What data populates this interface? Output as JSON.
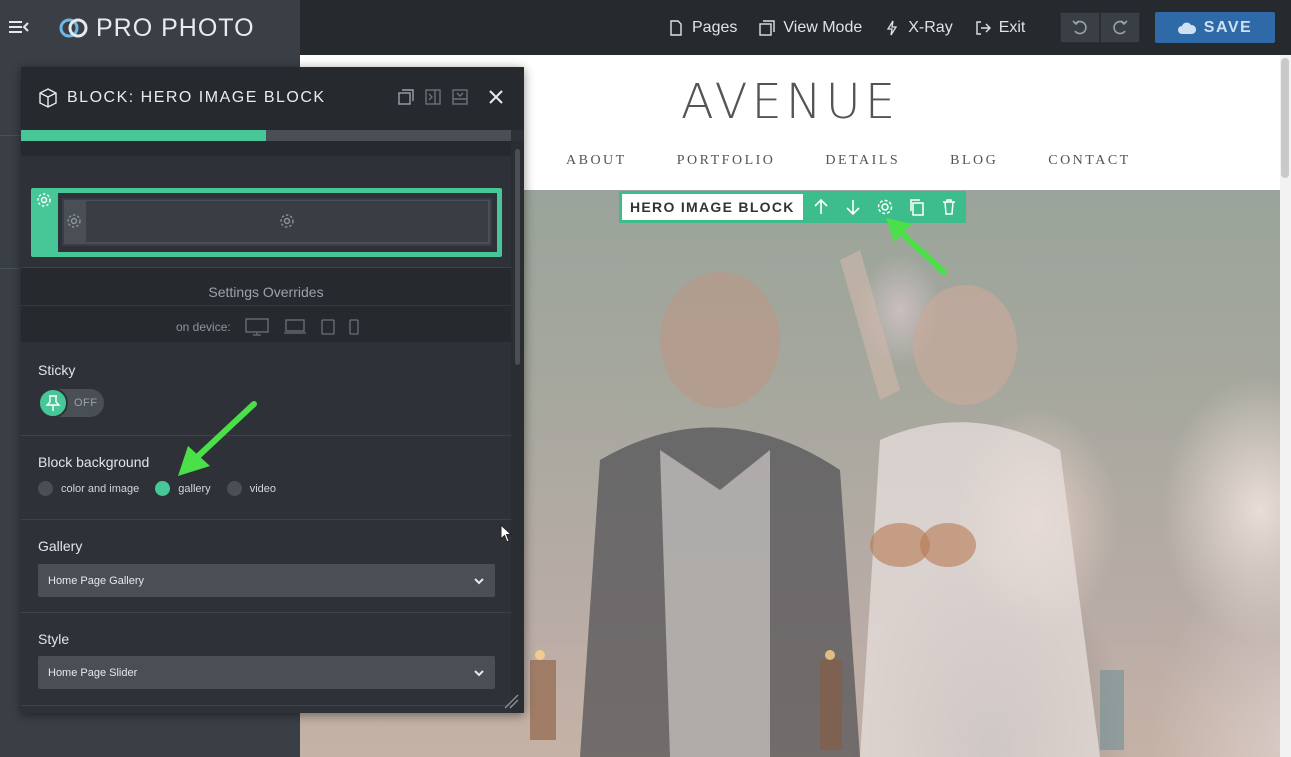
{
  "app": {
    "logo_text": "PRO PHOTO",
    "brand_color": "#47c698",
    "nav": [
      {
        "label": "Pages",
        "icon": "page-icon"
      },
      {
        "label": "View Mode",
        "icon": "view-mode-icon"
      },
      {
        "label": "X-Ray",
        "icon": "xray-icon"
      },
      {
        "label": "Exit",
        "icon": "exit-icon"
      }
    ],
    "save_label": "SAVE"
  },
  "site": {
    "title": "AVENUE",
    "nav": [
      "ABOUT",
      "PORTFOLIO",
      "DETAILS",
      "BLOG",
      "CONTACT"
    ],
    "block_toolbar_label": "HERO IMAGE BLOCK"
  },
  "panel": {
    "title": "BLOCK: HERO IMAGE BLOCK",
    "overrides_title": "Settings Overrides",
    "device_label": "on device:",
    "sticky": {
      "label": "Sticky",
      "state": "OFF"
    },
    "background": {
      "label": "Block background",
      "options": [
        "color and image",
        "gallery",
        "video"
      ],
      "selected": "gallery"
    },
    "gallery": {
      "label": "Gallery",
      "value": "Home Page Gallery"
    },
    "style": {
      "label": "Style",
      "value": "Home Page Slider"
    }
  }
}
